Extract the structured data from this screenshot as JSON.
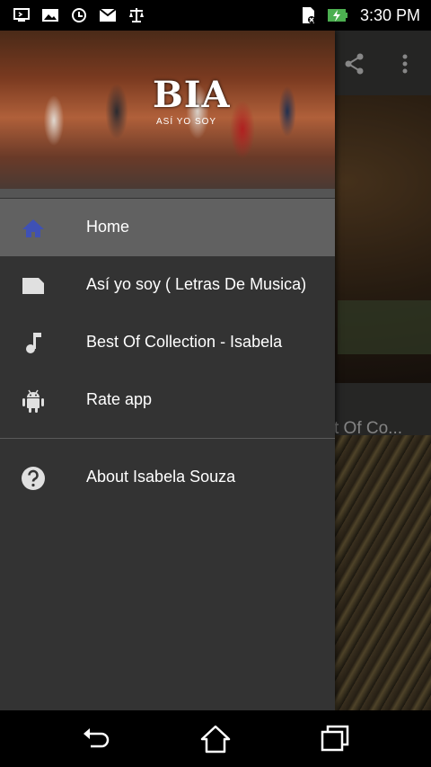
{
  "status_bar": {
    "time": "3:30 PM",
    "icons": [
      "usb-debug-icon",
      "image-icon",
      "sync-icon",
      "gmail-icon",
      "scale-icon",
      "sim-off-icon",
      "battery-charging-icon"
    ]
  },
  "background": {
    "card_text": "t Of Co...",
    "toolbar_icons": [
      "share-icon",
      "overflow-menu-icon"
    ]
  },
  "drawer": {
    "header": {
      "logo": "BIA",
      "subtitle": "ASÍ YO SOY"
    },
    "items": [
      {
        "label": "Home",
        "icon": "home-icon",
        "active": true
      },
      {
        "label": "Así yo soy ( Letras De Musica)",
        "icon": "document-icon",
        "active": false
      },
      {
        "label": "Best Of Collection - Isabela",
        "icon": "music-note-icon",
        "active": false
      },
      {
        "label": "Rate app",
        "icon": "android-icon",
        "active": false
      },
      {
        "label": "About Isabela Souza",
        "icon": "help-icon",
        "active": false
      }
    ]
  },
  "nav_bar": {
    "buttons": [
      "back-icon",
      "home-nav-icon",
      "recents-icon"
    ]
  },
  "colors": {
    "drawer_bg": "#333333",
    "active_item_bg": "#616161",
    "home_icon_active": "#3f51b5",
    "icon_default": "#e0e0e0"
  }
}
